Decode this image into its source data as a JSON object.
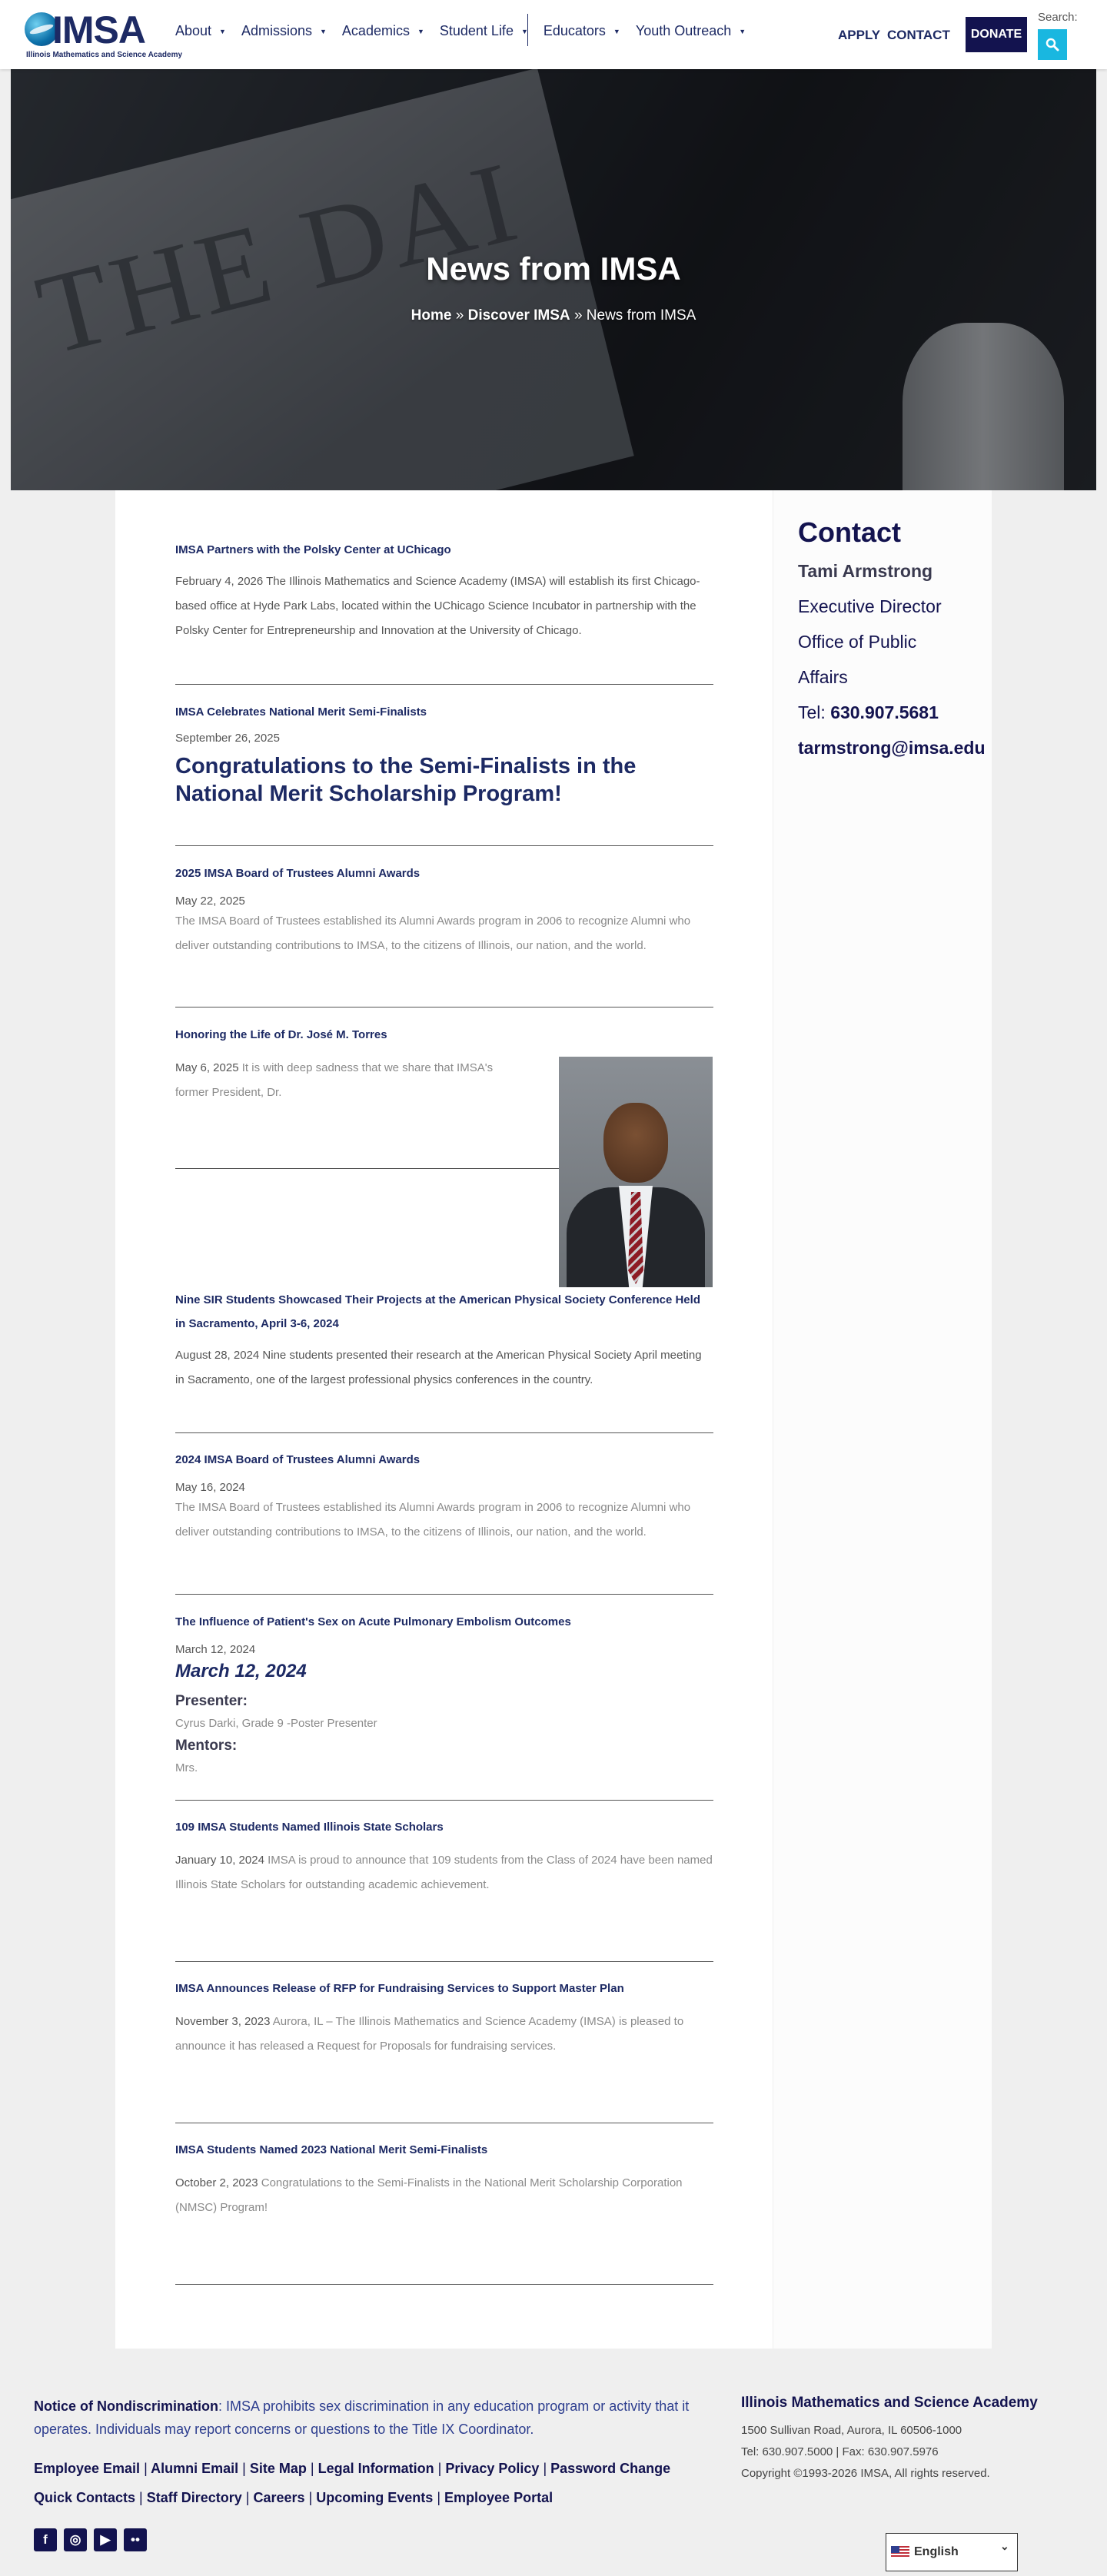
{
  "header": {
    "logo_text": "IMSA",
    "logo_subtitle": "Illinois Mathematics and Science Academy",
    "nav": [
      {
        "label": "About"
      },
      {
        "label": "Admissions"
      },
      {
        "label": "Academics"
      },
      {
        "label": "Student Life"
      },
      {
        "label": "Educators"
      },
      {
        "label": "Youth Outreach"
      }
    ],
    "apply_label": "APPLY",
    "contact_label": "CONTACT",
    "donate_label": "DONATE",
    "search_label": "Search:",
    "caret_glyph": "▼",
    "search_icon": "search-icon",
    "accent_color": "#19b7e0",
    "brand_color": "#13134f"
  },
  "hero": {
    "title": "News from IMSA",
    "breadcrumb_home": "Home",
    "breadcrumb_sep1": "»",
    "breadcrumb_section": "Discover IMSA",
    "breadcrumb_sep2": "»",
    "breadcrumb_current": "News from IMSA",
    "newspaper_text": "THE DAI"
  },
  "articles": [
    {
      "title": "IMSA Partners with the Polsky Center at UChicago",
      "body": "February 4, 2026 The Illinois Mathematics and Science Academy (IMSA) will establish its first Chicago-based office at Hyde Park Labs, located within the UChicago Science Incubator in partnership with the Polsky Center for Entrepreneurship and Innovation at the University of Chicago."
    },
    {
      "title": "IMSA Celebrates National Merit Semi-Finalists",
      "date": "September 26, 2025",
      "headline": "Congratulations to the Semi-Finalists in the National Merit Scholarship Program!"
    },
    {
      "title": "2025 IMSA Board of Trustees Alumni Awards",
      "date": "May 22, 2025",
      "body": "The IMSA Board of Trustees established its Alumni Awards program in 2006 to recognize Alumni who deliver outstanding contributions to IMSA, to the citizens of Illinois, our nation, and the world."
    },
    {
      "title": "Honoring the Life of Dr. José M. Torres",
      "date": "May 6, 2025",
      "body": "It is with deep sadness that we share that IMSA's former President, Dr."
    },
    {
      "title": "Nine SIR Students Showcased Their Projects at the American Physical Society Conference Held in Sacramento, April 3-6, 2024",
      "body": "August 28, 2024 Nine students presented their research at the American Physical Society April meeting in Sacramento, one of the largest professional physics conferences in the country."
    },
    {
      "title": "2024 IMSA Board of Trustees Alumni Awards",
      "date": "May 16, 2024",
      "body": "The IMSA Board of Trustees established its Alumni Awards program in 2006 to recognize Alumni who deliver outstanding contributions to IMSA, to the citizens of Illinois, our nation, and the world."
    },
    {
      "title": "The Influence of Patient's Sex on Acute Pulmonary Embolism Outcomes",
      "date": "March 12, 2024",
      "subhead": "March 12, 2024",
      "presenter_label": "Presenter:",
      "presenter": "Cyrus Darki, Grade 9 -Poster Presenter",
      "mentors_label": "Mentors:",
      "mentors": "Mrs."
    },
    {
      "title": "109 IMSA Students Named Illinois State Scholars",
      "date": "January 10, 2024",
      "body": "IMSA is proud to announce that 109 students from the Class of 2024 have been named Illinois State Scholars for outstanding academic achievement."
    },
    {
      "title": "IMSA Announces Release of RFP for Fundraising Services to Support Master Plan",
      "date": "November 3, 2023",
      "body": "Aurora, IL – The Illinois Mathematics and Science Academy (IMSA) is pleased to announce it has released a Request for Proposals for fundraising services."
    },
    {
      "title": "IMSA Students Named 2023 National Merit Semi-Finalists",
      "date": "October 2, 2023",
      "body": "Congratulations to the Semi-Finalists in the National Merit Scholarship Corporation (NMSC) Program!"
    }
  ],
  "sidebar": {
    "heading": "Contact",
    "name": "Tami Armstrong",
    "role": "Executive Director",
    "office_line1": "Office of Public",
    "office_line2": "Affairs",
    "tel_label": "Tel:",
    "tel": "630.907.5681",
    "email": "tarmstrong@imsa.edu"
  },
  "footer": {
    "notice_label": "Notice of Nondiscrimination",
    "notice_text": ": IMSA prohibits sex discrimination in any education program or activity that it operates. Individuals may report concerns or questions to the Title IX Coordinator.",
    "links_row1": [
      "Employee Email",
      "Alumni Email",
      "Site Map",
      "Legal Information",
      "Privacy Policy",
      "Password Change"
    ],
    "links_row2": [
      "Quick Contacts",
      "Staff Directory",
      "Careers",
      "Upcoming Events",
      "Employee Portal"
    ],
    "link_separator": "|",
    "social": [
      {
        "name": "facebook-icon",
        "glyph": "f"
      },
      {
        "name": "instagram-icon",
        "glyph": "◎"
      },
      {
        "name": "youtube-icon",
        "glyph": "▶"
      },
      {
        "name": "flickr-icon",
        "glyph": "••"
      }
    ],
    "org_name": "Illinois Mathematics and Science Academy",
    "address": "1500 Sullivan Road, Aurora, IL 60506-1000",
    "phones": "Tel: 630.907.5000 | Fax: 630.907.5976",
    "copyright": "Copyright ©1993-2026 IMSA, All rights reserved.",
    "language": "English",
    "language_chevron": "⌄"
  }
}
